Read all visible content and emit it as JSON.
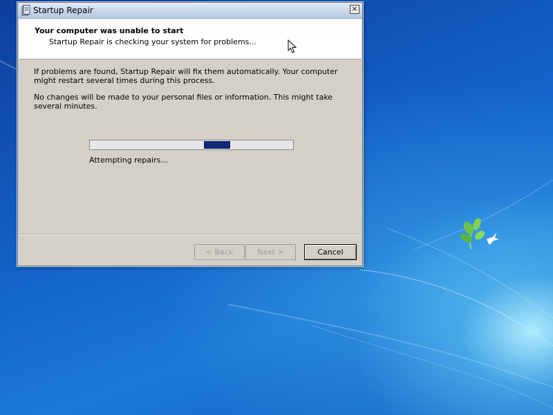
{
  "window": {
    "title": "Startup Repair",
    "close_glyph": "×"
  },
  "header": {
    "title": "Your computer was unable to start",
    "subtitle": "Startup Repair is checking your system for problems..."
  },
  "body": {
    "paragraph1": "If problems are found, Startup Repair will fix them automatically. Your computer might restart several times during this process.",
    "paragraph2": "No changes will be made to your personal files or information. This might take several minutes."
  },
  "progress": {
    "status_text": "Attempting repairs...",
    "mode": "marquee",
    "chunk_start_fraction": 0.56,
    "chunk_end_fraction": 0.69
  },
  "buttons": {
    "back_label": "< Back",
    "next_label": "Next >",
    "cancel_label": "Cancel"
  },
  "colors": {
    "progress_fill": "#0d2a72",
    "desktop_blue": "#1463c8",
    "dialog_face": "#d4d0c8"
  },
  "icons": {
    "window_icon": "startup-repair-icon",
    "close": "close-icon",
    "pointer": "mouse-cursor-icon",
    "wallpaper_logo": "plant-bird-logo"
  }
}
